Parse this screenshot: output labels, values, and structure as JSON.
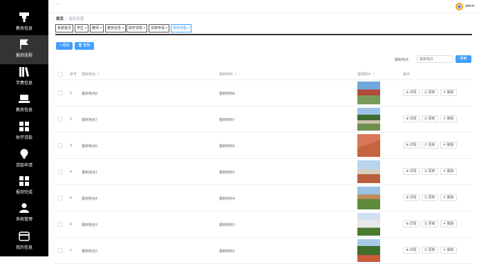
{
  "sidebar": {
    "items": [
      {
        "label": "教务信息",
        "icon": "tower-icon"
      },
      {
        "label": "报到流程",
        "icon": "flag-icon"
      },
      {
        "label": "学费信息",
        "icon": "books-icon"
      },
      {
        "label": "教务信息",
        "icon": "laptop-icon"
      },
      {
        "label": "助学贷款",
        "icon": "grid-icon"
      },
      {
        "label": "贷款申请",
        "icon": "bulb-icon"
      },
      {
        "label": "报到完成",
        "icon": "grid-icon"
      },
      {
        "label": "系统管理",
        "icon": "user-icon"
      },
      {
        "label": "我的信息",
        "icon": "card-icon"
      }
    ]
  },
  "header": {
    "menu_icon": "···",
    "username": "admin"
  },
  "breadcrumb": {
    "home": "首页",
    "separator": "/",
    "current": "报到流程"
  },
  "tags": [
    {
      "label": "系统首页"
    },
    {
      "label": "学生 ×"
    },
    {
      "label": "教师 ×"
    },
    {
      "label": "教务信息 ×"
    },
    {
      "label": "助学贷款 ×"
    },
    {
      "label": "贷款申请 ×"
    },
    {
      "label": "报到流程 ×"
    }
  ],
  "toolbar": {
    "add_label": "+ 增加",
    "delete_label": "🗑 删除"
  },
  "search": {
    "label": "报到地点",
    "placeholder": "报到地点",
    "button": "搜索"
  },
  "table": {
    "columns": [
      "序号",
      "报到地点",
      "报到材料",
      "报到照片",
      "操作"
    ],
    "sort_mark": "⇕",
    "actions": {
      "detail": "⊕ 详情",
      "edit": "⊡ 更新",
      "delete": "✕ 删除"
    },
    "rows": [
      {
        "index": "1",
        "location": "报到地点8",
        "material": "报到材料8"
      },
      {
        "index": "2",
        "location": "报到地点7",
        "material": "报到材料7"
      },
      {
        "index": "3",
        "location": "报到地点6",
        "material": "报到材料6"
      },
      {
        "index": "4",
        "location": "报到地点1",
        "material": "报到材料1"
      },
      {
        "index": "5",
        "location": "报到地点4",
        "material": "报到材料4"
      },
      {
        "index": "6",
        "location": "报到地点3",
        "material": "报到材料3"
      },
      {
        "index": "7",
        "location": "报到地点2",
        "material": "报到材料2"
      }
    ]
  },
  "colors": {
    "primary": "#409eff",
    "sidebar_bg": "#000000",
    "sidebar_active": "#333333"
  }
}
